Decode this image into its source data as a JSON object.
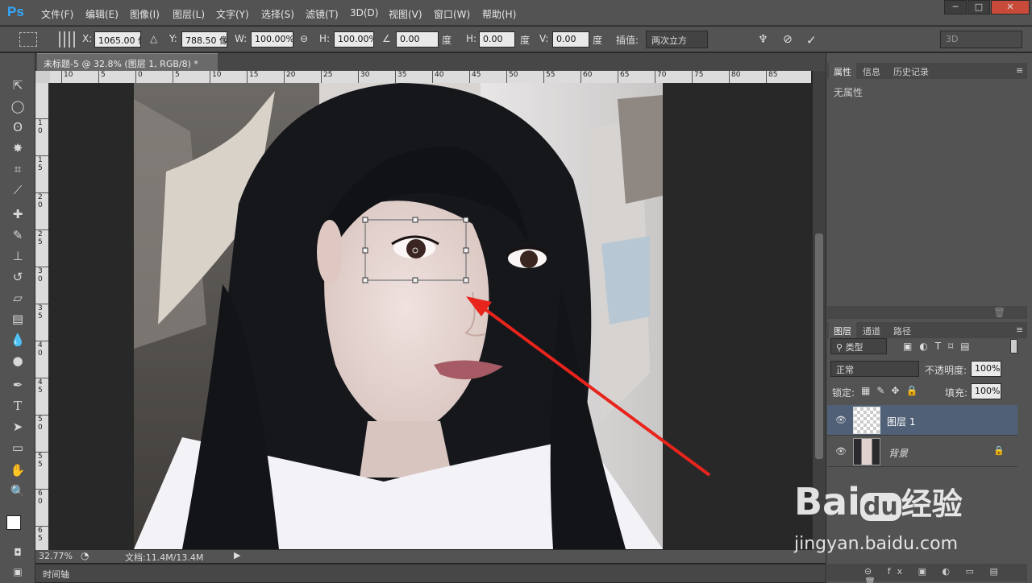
{
  "app": {
    "logo": "Ps"
  },
  "menu": [
    "文件(F)",
    "编辑(E)",
    "图像(I)",
    "图层(L)",
    "文字(Y)",
    "选择(S)",
    "滤镜(T)",
    "3D(D)",
    "视图(V)",
    "窗口(W)",
    "帮助(H)"
  ],
  "window_controls": [
    "─",
    "□",
    "✕"
  ],
  "options": {
    "x_label": "X:",
    "x_value": "1065.00 像",
    "y_label": "Y:",
    "y_value": "788.50 像",
    "w_label": "W:",
    "w_value": "100.00%",
    "h_label": "H:",
    "h_value": "100.00%",
    "angle_value": "0.00",
    "angle_unit": "度",
    "hskew_label": "H:",
    "hskew_value": "0.00",
    "hskew_unit": "度",
    "vskew_label": "V:",
    "vskew_value": "0.00",
    "vskew_unit": "度",
    "interp_label": "插值:",
    "interp_value": "两次立方",
    "workspace": "3D"
  },
  "document": {
    "tab_title": "未标题-5 @ 32.8% (图层 1, RGB/8) *",
    "close": "×"
  },
  "ruler": {
    "h_labels": [
      "10",
      "5",
      "0",
      "5",
      "10",
      "15",
      "20",
      "25",
      "30",
      "35",
      "40",
      "45",
      "50",
      "55",
      "60",
      "65",
      "70",
      "75",
      "80",
      "85"
    ],
    "v_labels": [
      "1 0",
      "1 5",
      "2 0",
      "2 5",
      "3 0",
      "3 5",
      "4 0",
      "4 5",
      "5 0",
      "5 5",
      "6 0",
      "6 5"
    ]
  },
  "status": {
    "zoom": "32.77%",
    "doc_info": "文档:11.4M/13.4M"
  },
  "timeline_label": "时间轴",
  "properties_panel": {
    "tabs": [
      "属性",
      "信息",
      "历史记录"
    ],
    "empty_text": "无属性"
  },
  "layers_panel": {
    "tabs": [
      "图层",
      "通道",
      "路径"
    ],
    "filter_kind": "类型",
    "blend_mode": "正常",
    "opacity_label": "不透明度:",
    "opacity_value": "100%",
    "lock_label": "锁定:",
    "fill_label": "填充:",
    "fill_value": "100%",
    "layers": [
      {
        "name": "图层 1",
        "selected": true
      },
      {
        "name": "背景",
        "selected": false
      }
    ]
  },
  "watermark": {
    "brand": "Bai",
    "paw": "du",
    "cn": "经验",
    "url": "jingyan.baidu.com"
  },
  "colors": {
    "accent": "#31a8ff",
    "arrow": "#e8241c",
    "selected_layer": "#4f6077"
  }
}
